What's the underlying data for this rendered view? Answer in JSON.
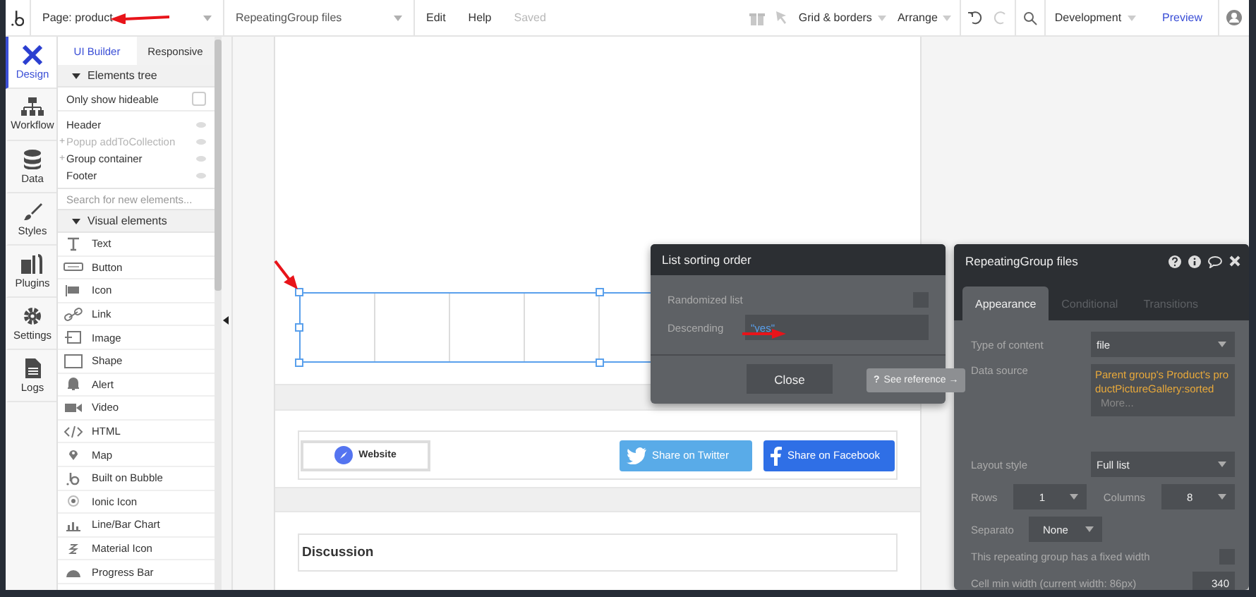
{
  "top_bar": {
    "page_selector": "Page: product",
    "element_selector": "RepeatingGroup files",
    "menus": [
      {
        "label": "Edit",
        "disabled": false
      },
      {
        "label": "Help",
        "disabled": false
      },
      {
        "label": "Saved",
        "disabled": true
      }
    ],
    "grid_menu": "Grid & borders",
    "arrange_menu": "Arrange",
    "redo_disabled": true,
    "environment": "Development",
    "preview": "Preview"
  },
  "nav": [
    {
      "label": "Design",
      "kind": "design",
      "selected": true
    },
    {
      "label": "Workflow",
      "kind": "workflow",
      "selected": false
    },
    {
      "label": "Data",
      "kind": "data",
      "selected": false
    },
    {
      "label": "Styles",
      "kind": "styles",
      "selected": false
    },
    {
      "label": "Plugins",
      "kind": "plugins",
      "selected": false
    },
    {
      "label": "Settings",
      "kind": "settings",
      "selected": false
    },
    {
      "label": "Logs",
      "kind": "logs",
      "selected": false
    }
  ],
  "panel": {
    "tabs": [
      {
        "label": "UI Builder",
        "selected": true
      },
      {
        "label": "Responsive",
        "selected": false
      }
    ],
    "tree_section": {
      "title": "Elements tree",
      "expanded": true
    },
    "hideable_filter": {
      "label": "Only show hideable",
      "checked": false
    },
    "tree": [
      {
        "label": "Header",
        "hidden": false
      },
      {
        "label": "Popup addToCollection",
        "toggle": "+",
        "hidden": true
      },
      {
        "label": "Group container",
        "toggle": "+",
        "hidden": false
      },
      {
        "label": "Footer",
        "hidden": false
      }
    ],
    "search": {
      "placeholder": "Search for new elements..."
    },
    "visual_section": {
      "title": "Visual elements",
      "expanded": true
    },
    "elements": [
      {
        "label": "Text",
        "kind": "text"
      },
      {
        "label": "Button",
        "kind": "button"
      },
      {
        "label": "Icon",
        "kind": "flag"
      },
      {
        "label": "Link",
        "kind": "link"
      },
      {
        "label": "Image",
        "kind": "image"
      },
      {
        "label": "Shape",
        "kind": "shape"
      },
      {
        "label": "Alert",
        "kind": "bell"
      },
      {
        "label": "Video",
        "kind": "video"
      },
      {
        "label": "HTML",
        "kind": "code"
      },
      {
        "label": "Map",
        "kind": "pin"
      },
      {
        "label": "Built on Bubble",
        "kind": "bubble"
      },
      {
        "label": "Ionic Icon",
        "kind": "dot"
      },
      {
        "label": "Line/Bar Chart",
        "kind": "chart"
      },
      {
        "label": "Material Icon",
        "kind": "material"
      },
      {
        "label": "Progress Bar",
        "kind": "gauge"
      }
    ]
  },
  "canvas": {
    "website_button": "Website",
    "twitter_button": "Share on Twitter",
    "facebook_button": "Share on Facebook",
    "discussion_title": "Discussion"
  },
  "sorting_popup": {
    "title": "List sorting order",
    "randomized": {
      "label": "Randomized list",
      "checked": false
    },
    "descending": {
      "label": "Descending",
      "value": "\"yes\""
    },
    "close": "Close"
  },
  "tooltip": {
    "mark": "?",
    "text": "See reference →"
  },
  "property_panel": {
    "title": "RepeatingGroup files",
    "tabs": [
      {
        "label": "Appearance",
        "selected": true
      },
      {
        "label": "Conditional",
        "selected": false
      },
      {
        "label": "Transitions",
        "selected": false
      }
    ],
    "type_of_content": {
      "label": "Type of content",
      "value": "file"
    },
    "data_source": {
      "label": "Data source",
      "value": "Parent group's Product's productPictureGallery:sorted",
      "more": "More..."
    },
    "layout_style": {
      "label": "Layout style",
      "value": "Full list"
    },
    "rows": {
      "label": "Rows",
      "value": "1"
    },
    "columns": {
      "label": "Columns",
      "value": "8"
    },
    "separator": {
      "label": "Separato",
      "value": "None"
    },
    "fixed_width": {
      "label": "This repeating group has a fixed width",
      "checked": false
    },
    "cell_min_width": {
      "label": "Cell min width (current width: 86px)",
      "value": "340"
    }
  }
}
